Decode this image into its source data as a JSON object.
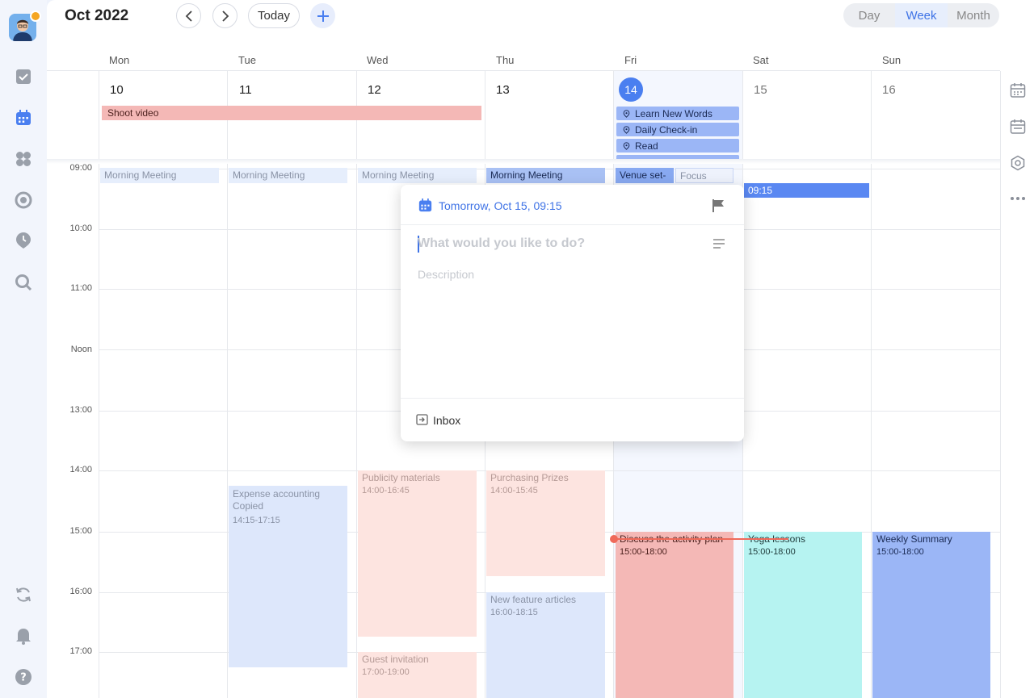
{
  "header": {
    "title": "Oct 2022",
    "today_label": "Today",
    "views": [
      "Day",
      "Week",
      "Month"
    ],
    "active_view": "Week"
  },
  "days": [
    {
      "name": "Mon",
      "num": "10"
    },
    {
      "name": "Tue",
      "num": "11"
    },
    {
      "name": "Wed",
      "num": "12"
    },
    {
      "name": "Thu",
      "num": "13"
    },
    {
      "name": "Fri",
      "num": "14"
    },
    {
      "name": "Sat",
      "num": "15"
    },
    {
      "name": "Sun",
      "num": "16"
    }
  ],
  "times": [
    "09:00",
    "10:00",
    "11:00",
    "Noon",
    "13:00",
    "14:00",
    "15:00",
    "16:00",
    "17:00"
  ],
  "allday": {
    "shoot_video": "Shoot video",
    "fri_chips": [
      "Learn New Words",
      "Daily Check-in",
      "Read"
    ]
  },
  "events": {
    "morning_meeting": "Morning Meeting",
    "venue": "Venue set-",
    "focus": "Focus",
    "sat_0915": "09:15",
    "expense_title": "Expense accounting Copied",
    "expense_time": "14:15-17:15",
    "publicity_title": "Publicity materials",
    "publicity_time": "14:00-16:45",
    "prizes_title": "Purchasing Prizes",
    "prizes_time": "14:00-15:45",
    "feature_title": "New feature articles",
    "feature_time": "16:00-18:15",
    "guest_title": "Guest invitation",
    "guest_time": "17:00-19:00",
    "discuss_title": "Discuss the activity plan",
    "discuss_time": "15:00-18:00",
    "yoga_title": "Yoga lessons",
    "yoga_time": "15:00-18:00",
    "weekly_title": "Weekly Summary",
    "weekly_time": "15:00-18:00"
  },
  "popup": {
    "date": "Tomorrow, Oct 15, 09:15",
    "placeholder": "What would you like to do?",
    "description_placeholder": "Description",
    "list": "Inbox"
  },
  "colors": {
    "accent": "#4a7ff0",
    "light_blue": "#dde7fb",
    "light_red": "#fde4e0",
    "red": "#f4b8b6",
    "cyan": "#b6f3f1",
    "blue": "#9bb6f6"
  }
}
